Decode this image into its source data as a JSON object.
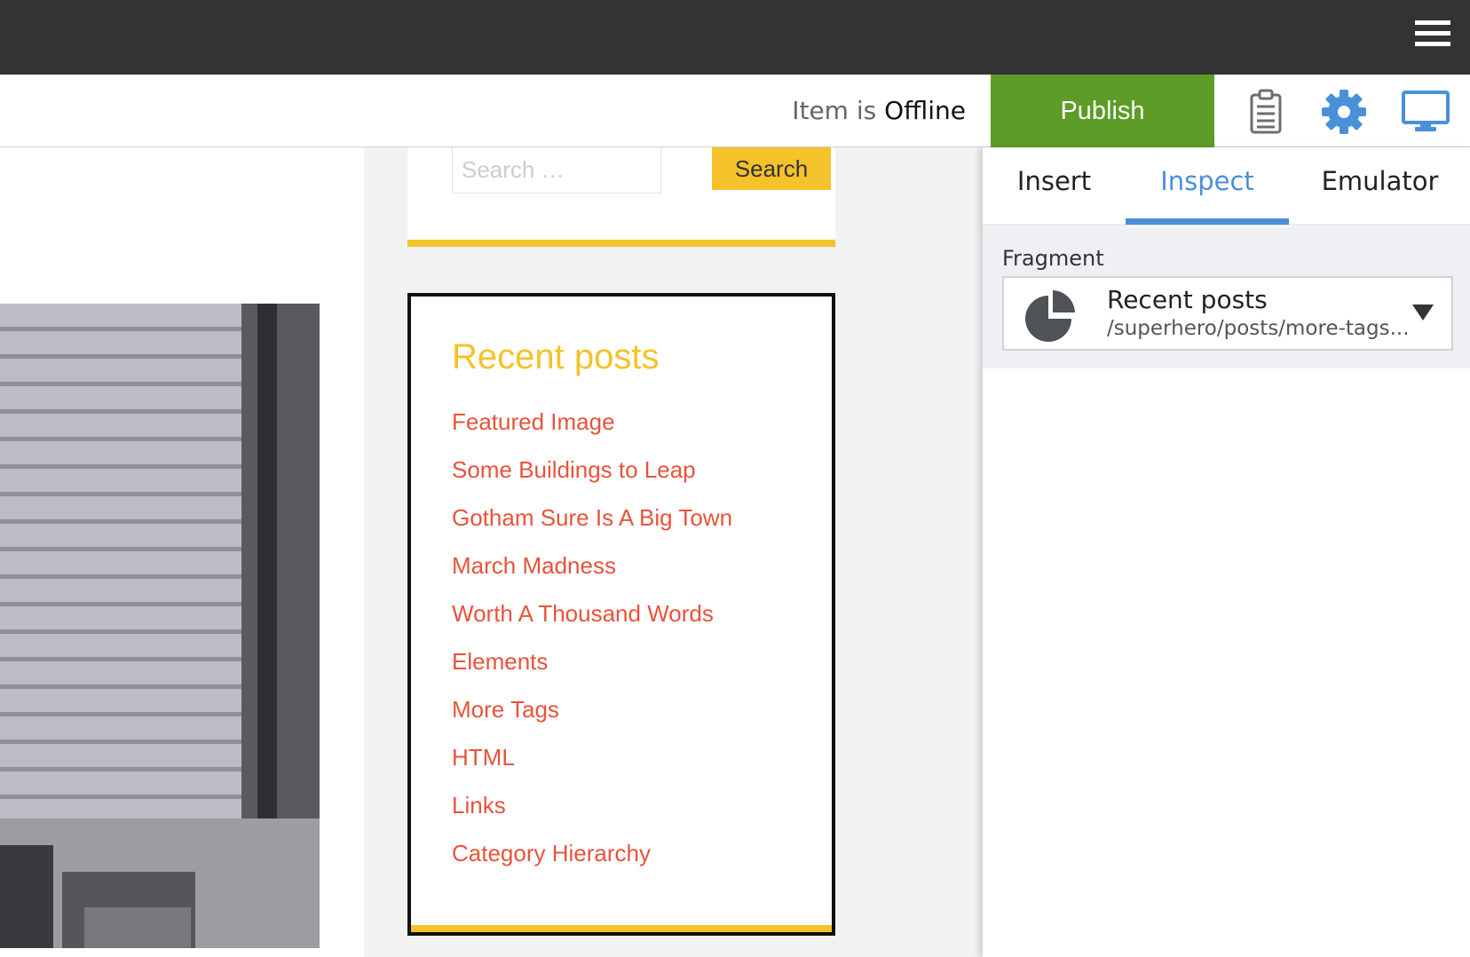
{
  "topbar": {
    "menu_icon": "hamburger-menu-icon"
  },
  "toolbar": {
    "status_prefix": "Item is",
    "status_value": "Offline",
    "publish_label": "Publish",
    "icons": [
      "clipboard-icon",
      "gear-icon",
      "monitor-icon"
    ],
    "accent": "#5d9c27"
  },
  "preview": {
    "search": {
      "placeholder": "Search …",
      "button_label": "Search"
    },
    "recent_posts": {
      "title": "Recent posts",
      "items": [
        "Featured Image",
        "Some Buildings to Leap",
        "Gotham Sure Is A Big Town",
        "March Madness",
        "Worth A Thousand Words",
        "Elements",
        "More Tags",
        "HTML",
        "Links",
        "Category Hierarchy"
      ]
    },
    "colors": {
      "widget_accent": "#f4c22b",
      "link": "#e8533b"
    }
  },
  "panel": {
    "tabs": [
      "Insert",
      "Inspect",
      "Emulator"
    ],
    "active_tab": "Inspect",
    "fragment": {
      "label": "Fragment",
      "selected_title": "Recent posts",
      "selected_path": "/superhero/posts/more-tags...",
      "icon": "pie-chart-icon"
    },
    "colors": {
      "tab_active": "#4a90d9"
    }
  }
}
